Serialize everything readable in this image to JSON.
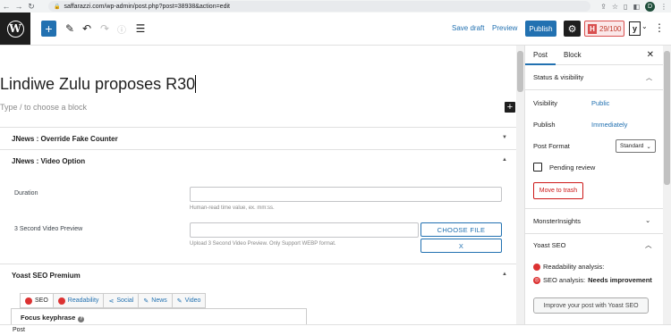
{
  "browser": {
    "url": "saffarazzi.com/wp-admin/post.php?post=38938&action=edit",
    "avatar_initial": "D"
  },
  "toolbar": {
    "logo": "W",
    "save_draft": "Save draft",
    "preview": "Preview",
    "publish": "Publish",
    "seo_score": "29/100",
    "seo_letter": "H",
    "yoast_letter": "y"
  },
  "editor": {
    "title": "Lindiwe Zulu proposes R30",
    "block_hint": "Type / to choose a block",
    "metaboxes": {
      "fake_counter": "JNews : Override Fake Counter",
      "video_option": "JNews : Video Option",
      "yoast": "Yoast SEO Premium"
    },
    "video": {
      "duration_label": "Duration",
      "duration_help": "Human-read time value, ex. mm:ss.",
      "preview_label": "3 Second Video Preview",
      "preview_help": "Upload 3 Second Video Preview. Only Support WEBP format.",
      "choose_file": "CHOOSE FILE",
      "remove": "X"
    },
    "yoast_tabs": [
      "SEO",
      "Readability",
      "Social",
      "News",
      "Video"
    ],
    "focus_keyphrase": "Focus keyphrase"
  },
  "sidebar": {
    "tab_post": "Post",
    "tab_block": "Block",
    "status_heading": "Status & visibility",
    "visibility_label": "Visibility",
    "visibility_value": "Public",
    "publish_label": "Publish",
    "publish_value": "Immediately",
    "format_label": "Post Format",
    "format_value": "Standard",
    "pending_review": "Pending review",
    "move_trash": "Move to trash",
    "monsterinsights": "MonsterInsights",
    "yoast_heading": "Yoast SEO",
    "readability": "Readability analysis:",
    "seo_analysis_label": "SEO analysis:",
    "seo_analysis_value": "Needs improvement",
    "improve_button": "Improve your post with Yoast SEO"
  },
  "footer": {
    "breadcrumb": "Post"
  },
  "colors": {
    "accent": "#2271b1",
    "danger": "#dc3232",
    "dark": "#1e1e1e"
  }
}
